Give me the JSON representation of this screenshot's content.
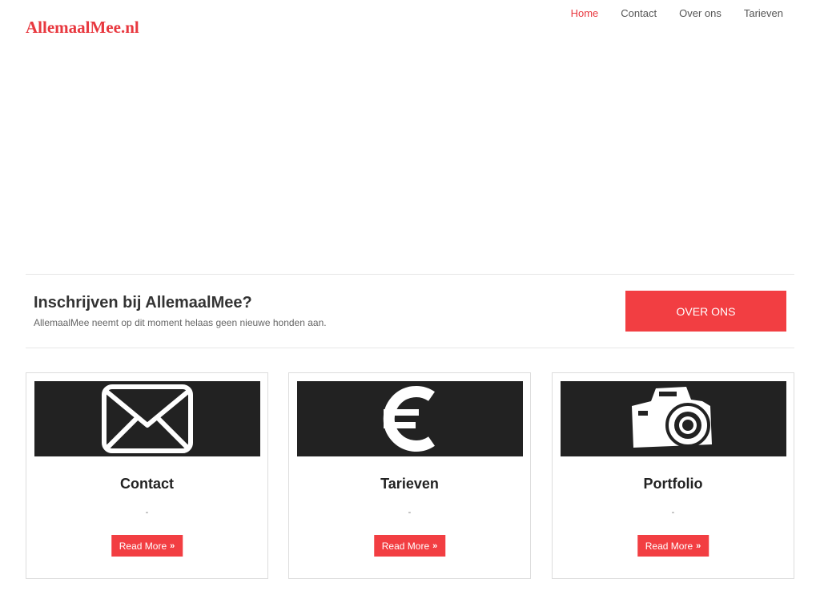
{
  "brand": {
    "logo_text": "AllemaalMee.nl",
    "accent_color": "#f23e42"
  },
  "nav": {
    "items": [
      {
        "label": "Home",
        "active": true
      },
      {
        "label": "Contact",
        "active": false
      },
      {
        "label": "Over ons",
        "active": false
      },
      {
        "label": "Tarieven",
        "active": false
      }
    ]
  },
  "cta": {
    "title": "Inschrijven bij AllemaalMee?",
    "text": "AllemaalMee neemt op dit moment helaas geen nieuwe honden aan.",
    "button_label": "OVER ONS"
  },
  "cards": [
    {
      "title": "Contact",
      "text": "-",
      "button_label": "Read More",
      "icon": "envelope-icon"
    },
    {
      "title": "Tarieven",
      "text": "-",
      "button_label": "Read More",
      "icon": "euro-icon"
    },
    {
      "title": "Portfolio",
      "text": "-",
      "button_label": "Read More",
      "icon": "camera-icon"
    }
  ]
}
